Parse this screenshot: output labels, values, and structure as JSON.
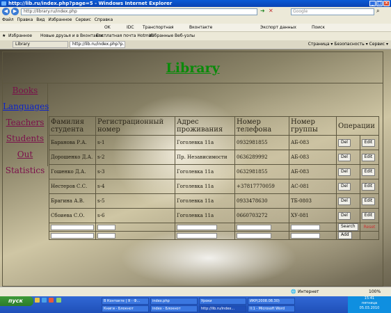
{
  "window": {
    "title": "http://lib.ru/index.php?page=5 - Windows Internet Explorer"
  },
  "browser": {
    "address": "http://library.ru/index.php",
    "search_placeholder": "Google",
    "menu": [
      "Файл",
      "Правка",
      "Вид",
      "Избранное",
      "Сервис",
      "Справка"
    ],
    "toolbar": [
      "OK",
      "IDC",
      "Транспортная",
      "Вконтакте",
      "Экспорт данных",
      "Поиск"
    ],
    "favorites_label": "Избранное",
    "favorites": [
      "Новые друзья и в Вконтакте",
      "Бесплатная почта Hotmail",
      "Избранные Веб-узлы"
    ],
    "tabs": [
      "Library",
      "http://lib.ru/index.php?p..."
    ],
    "commands": "Страница ▾  Безопасность ▾  Сервис ▾"
  },
  "page": {
    "title": "Library",
    "nav": [
      {
        "label": "Books",
        "style": "maroon"
      },
      {
        "label": "Languages",
        "style": "blue"
      },
      {
        "label": "Teachers",
        "style": "maroon"
      },
      {
        "label": "Students",
        "style": "maroon"
      },
      {
        "label": "Out",
        "style": "maroon"
      },
      {
        "label": "Statistics",
        "style": "plain"
      }
    ],
    "columns": [
      "Фамилия студента",
      "Регистрационный номер",
      "Адрес проживания",
      "Номер телефона",
      "Номер группы",
      "Операции"
    ],
    "rows": [
      [
        "Баранова Р.А.",
        "s-1",
        "Гоголевка 11а",
        "0932981855",
        "АБ-083"
      ],
      [
        "Дорошенко Д.А.",
        "s-2",
        "Пр. Независимости",
        "0636289992",
        "АБ-083"
      ],
      [
        "Гошенко Д.А.",
        "s-3",
        "Гоголевка 11а",
        "0632981855",
        "АБ-083"
      ],
      [
        "Нестеров С.С.",
        "s-4",
        "Гоголевка 11а",
        "+37817770059",
        "АС-081"
      ],
      [
        "Брагина А.В.",
        "s-5",
        "Гоголевка 11а",
        "0933478630",
        "ТБ-0803"
      ],
      [
        "Сбоиева С.О.",
        "s-6",
        "Гоголевка 11а",
        "0660703272",
        "ХУ-081"
      ]
    ],
    "del_label": "Del",
    "edit_label": "Edit",
    "search_label": "Search",
    "add_label": "Add",
    "reset_label": "Reset"
  },
  "statusbar": {
    "zone": "Интернет",
    "zoom": "100%"
  },
  "taskbar": {
    "start": "пуск",
    "tasks": [
      "В Контакте | Я - Ф...",
      "index.php",
      "Уроки",
      "ИКР(2008.08.30)",
      "Книги - Блокнот",
      "index - Блокнот",
      "http://lib.ru/index...",
      "II:1 - Microsoft Word"
    ],
    "time": "15:41",
    "day": "пятница",
    "date": "05.03.2010"
  }
}
